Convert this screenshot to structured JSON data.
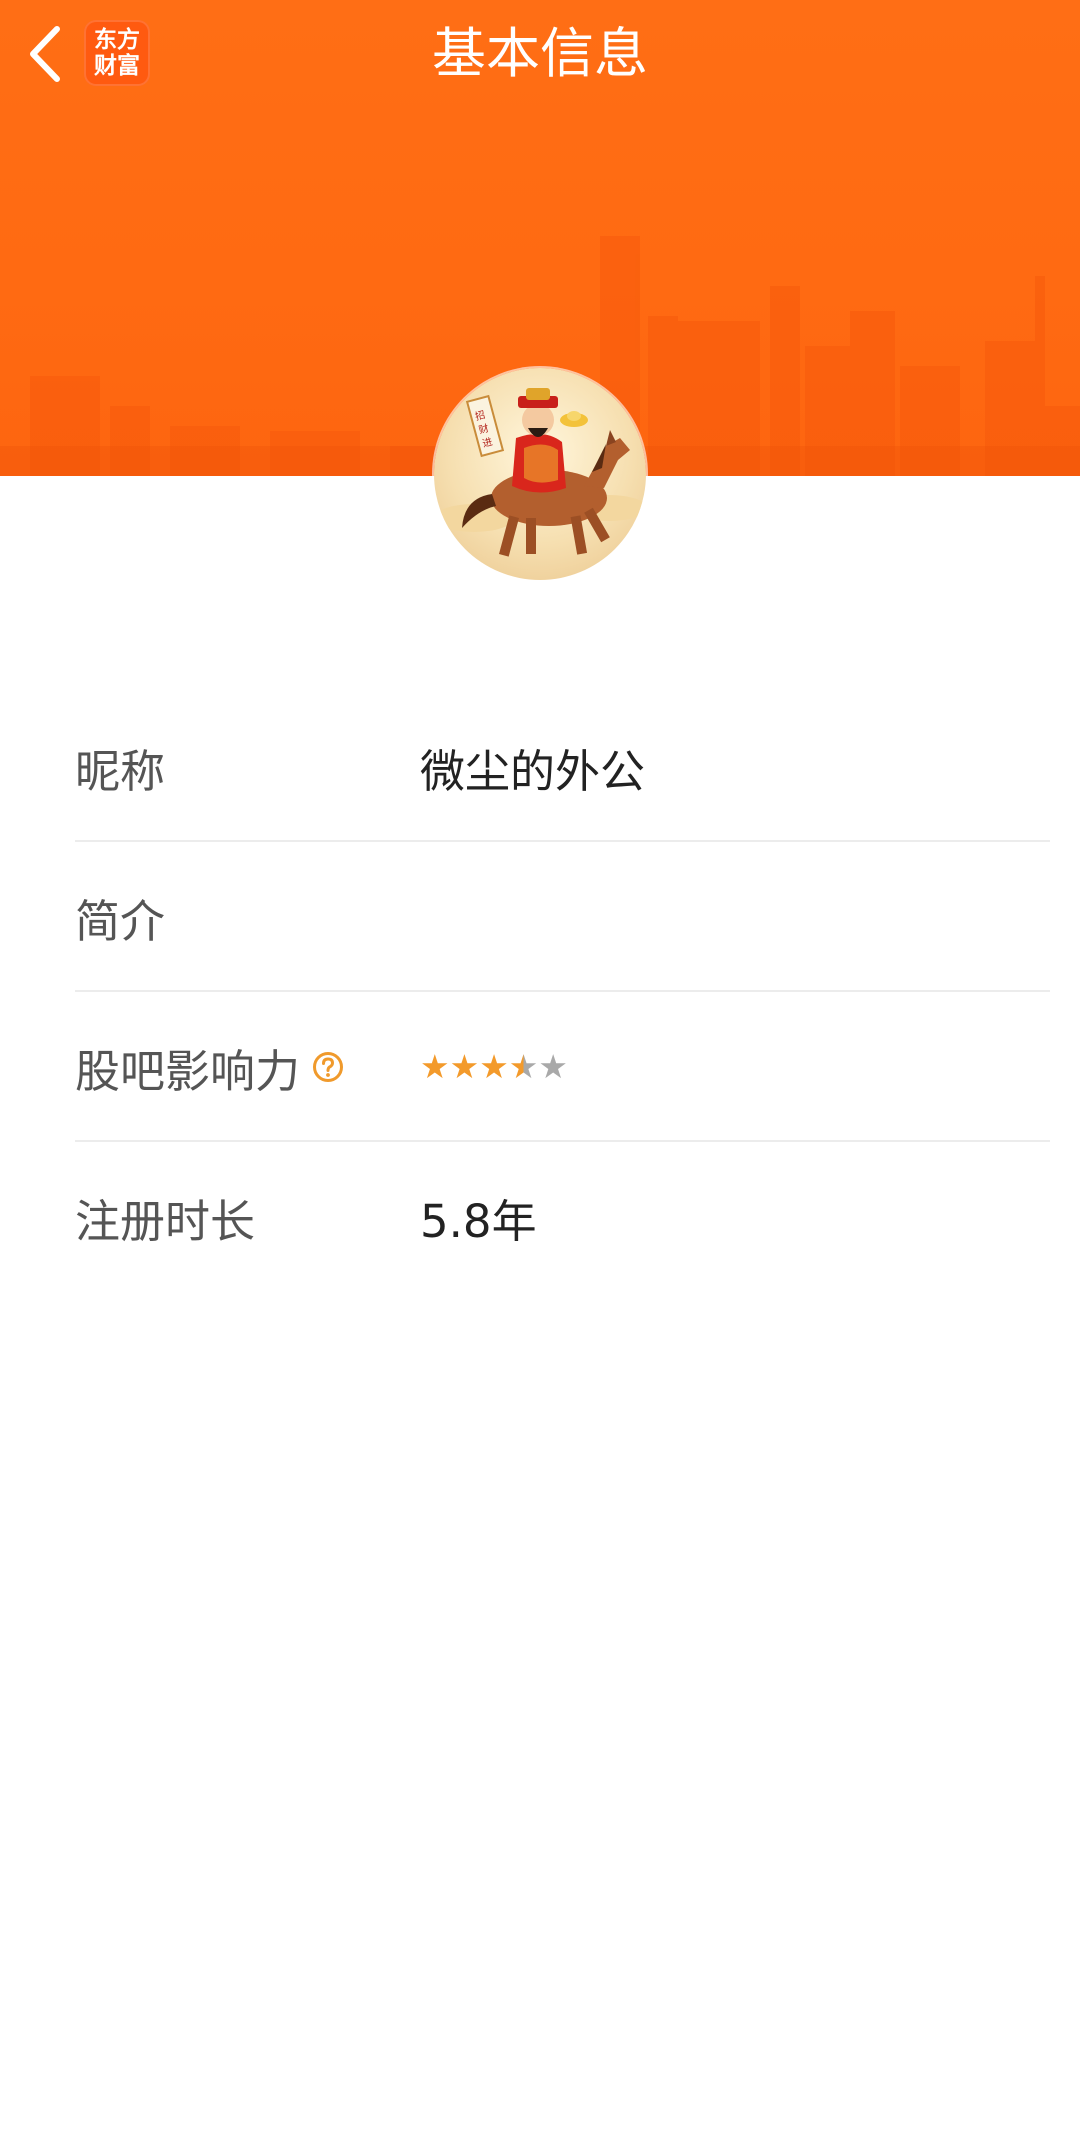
{
  "header": {
    "title": "基本信息",
    "brand_line1": "东方",
    "brand_line2": "财富"
  },
  "profile": {
    "nickname_label": "昵称",
    "nickname_value": "微尘的外公",
    "intro_label": "简介",
    "intro_value": "",
    "influence_label": "股吧影响力",
    "influence_rating": 3.5,
    "influence_max": 5,
    "register_label": "注册时长",
    "register_value": "5.8年"
  },
  "colors": {
    "brand_orange": "#ff6a12",
    "star_filled": "#f39a2b",
    "star_empty": "#a9a9a9",
    "help_icon": "#f09a2c"
  },
  "icons": {
    "back": "chevron-left-icon",
    "help": "question-circle-icon",
    "star": "star-icon"
  }
}
